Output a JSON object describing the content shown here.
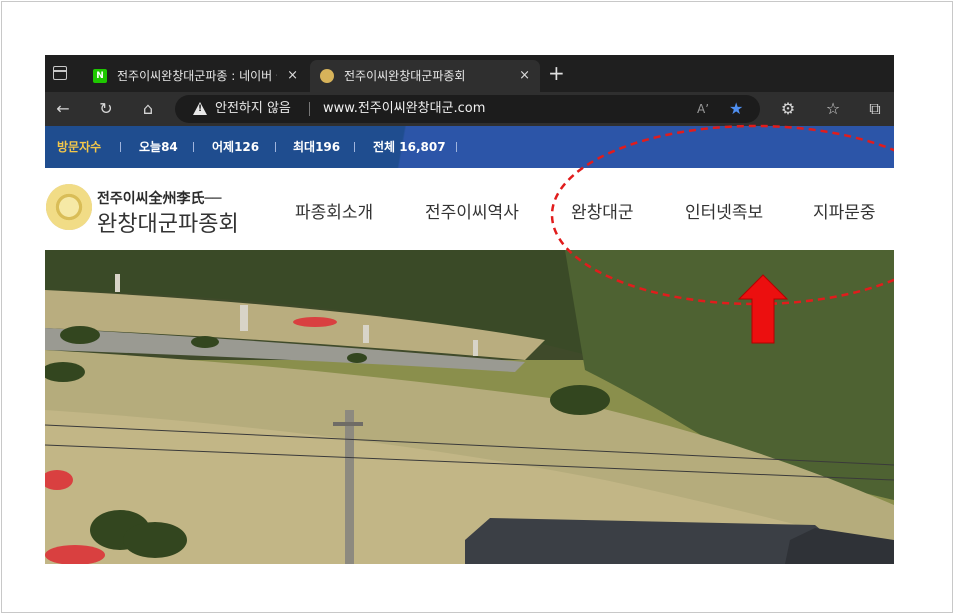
{
  "browser": {
    "tabs": [
      {
        "title": "전주이씨완창대군파종 : 네이버 블",
        "favicon": "naver-icon",
        "active": false,
        "close": "×"
      },
      {
        "title": "전주이씨완창대군파종회",
        "favicon": "seal-icon",
        "active": true,
        "close": "×"
      }
    ],
    "new_tab": "+",
    "security_text": "안전하지 않음",
    "url": "www.전주이씨완창대군.com",
    "read_aloud": "Aʼ"
  },
  "visitor_bar": {
    "label": "방문자수",
    "today": "오늘84",
    "yesterday": "어제126",
    "max": "최대196",
    "total": "전체 16,807",
    "separator": "|"
  },
  "site": {
    "logo_line1": "전주이씨全州李氏──",
    "logo_line2": "완창대군파종회",
    "nav": [
      "파종회소개",
      "전주이씨역사",
      "완창대군",
      "인터넷족보",
      "지파문중"
    ]
  },
  "annotation": {
    "color": "#e11c1c",
    "ellipse_style": "dashed",
    "arrow_direction": "up",
    "target": "인터넷족보"
  },
  "colors": {
    "tabbar": "#1f1f1f",
    "toolbar": "#2f2f2f",
    "visitor_bar": "#1f4d8f",
    "visitor_label": "#f3c74a",
    "star": "#4f8ff0"
  }
}
